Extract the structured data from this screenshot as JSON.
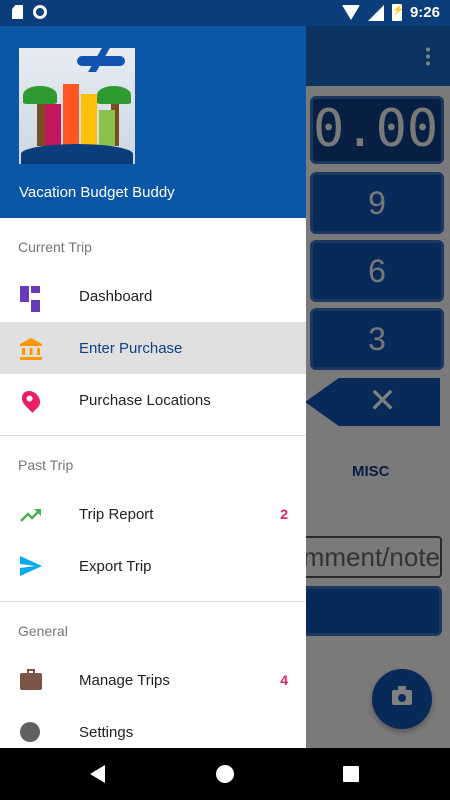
{
  "status_bar": {
    "time": "9:26",
    "icons": [
      "sd-card-icon",
      "circle-icon",
      "wifi-icon",
      "signal-icon",
      "battery-charging-icon"
    ]
  },
  "background_app": {
    "display_value": "0.00",
    "keys": [
      "9",
      "6",
      "3"
    ],
    "backspace_symbol": "✕",
    "category_label": "MISC",
    "note_placeholder": "comment/note"
  },
  "drawer": {
    "app_name": "Vacation Budget Buddy",
    "sections": [
      {
        "title": "Current Trip",
        "items": [
          {
            "label": "Dashboard",
            "icon": "dashboard-icon",
            "badge": ""
          },
          {
            "label": "Enter Purchase",
            "icon": "bank-icon",
            "badge": "",
            "active": true
          },
          {
            "label": "Purchase Locations",
            "icon": "location-pin-icon",
            "badge": ""
          }
        ]
      },
      {
        "title": "Past Trip",
        "items": [
          {
            "label": "Trip Report",
            "icon": "trending-up-icon",
            "badge": "2"
          },
          {
            "label": "Export Trip",
            "icon": "send-icon",
            "badge": ""
          }
        ]
      },
      {
        "title": "General",
        "items": [
          {
            "label": "Manage Trips",
            "icon": "briefcase-icon",
            "badge": "4"
          },
          {
            "label": "Settings",
            "icon": "gear-icon",
            "badge": ""
          }
        ]
      }
    ]
  },
  "colors": {
    "primary": "#0b56a6",
    "dashboard_icon": "#673ab7",
    "bank_icon": "#ff9800",
    "pin_icon": "#e91e63",
    "trend_icon": "#4caf50",
    "send_icon": "#03a9f4",
    "briefcase_icon": "#795548",
    "badge": "#e91e63"
  }
}
